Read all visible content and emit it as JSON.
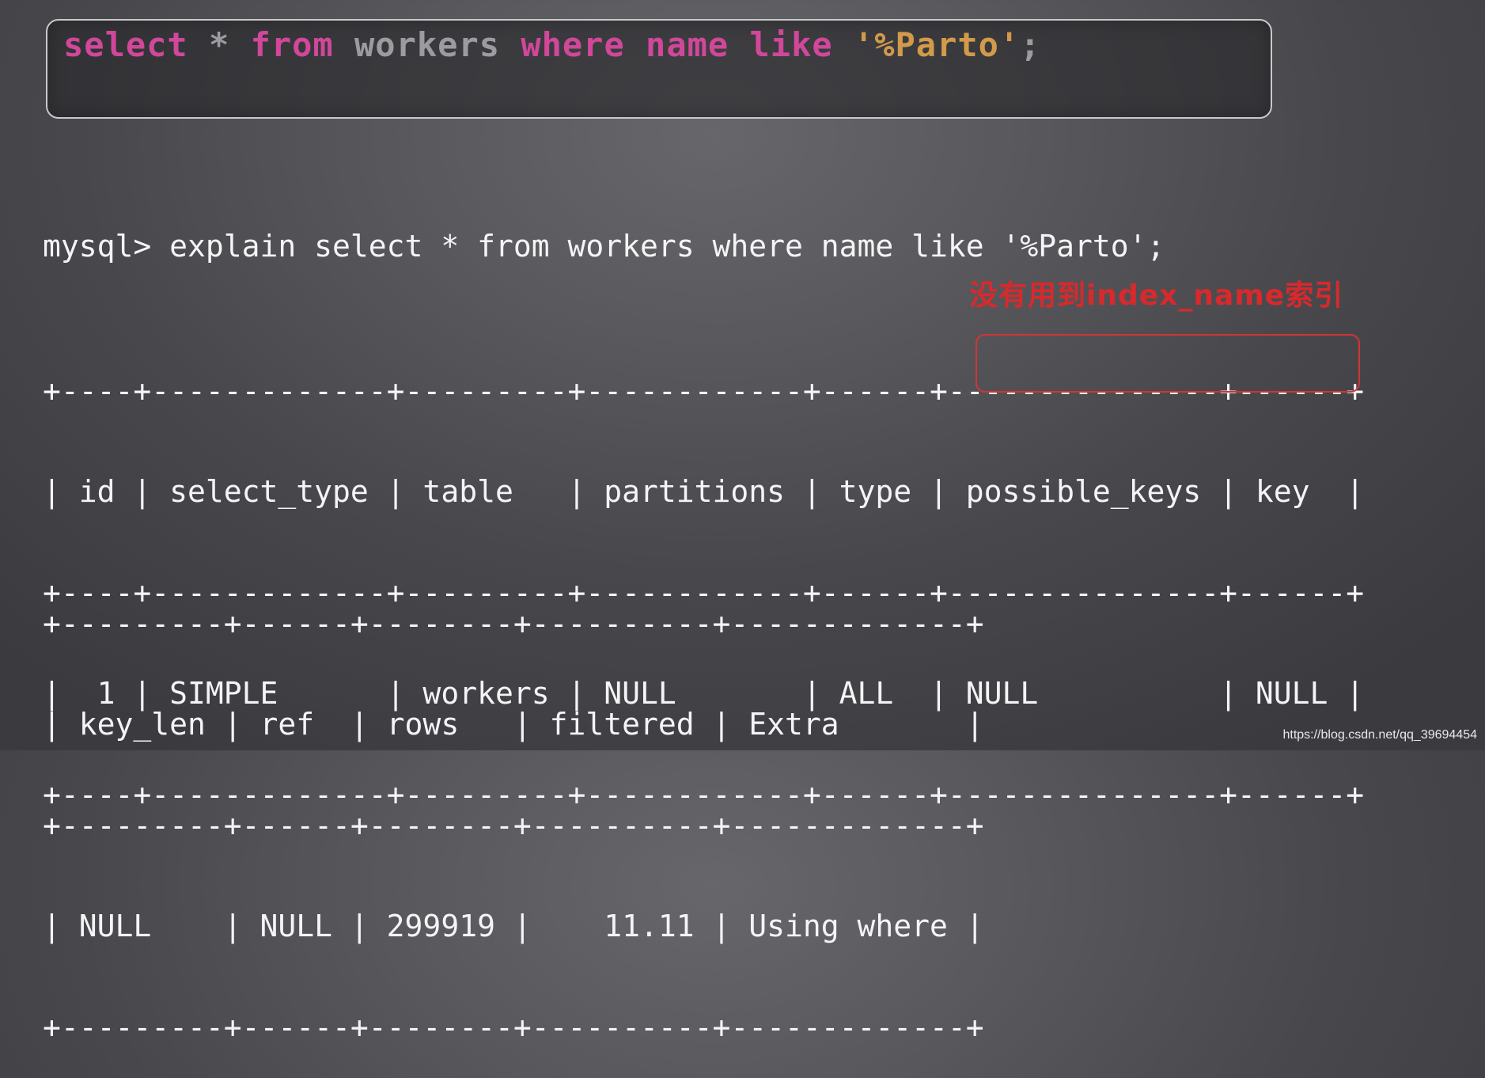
{
  "sql_box": {
    "tokens": [
      {
        "text": "select",
        "kind": "kw"
      },
      {
        "text": " * ",
        "kind": "plain"
      },
      {
        "text": "from",
        "kind": "kw"
      },
      {
        "text": " workers ",
        "kind": "plain"
      },
      {
        "text": "where",
        "kind": "kw"
      },
      {
        "text": " ",
        "kind": "plain"
      },
      {
        "text": "name",
        "kind": "kw"
      },
      {
        "text": " ",
        "kind": "plain"
      },
      {
        "text": "like",
        "kind": "kw"
      },
      {
        "text": " ",
        "kind": "plain"
      },
      {
        "text": "'%Parto'",
        "kind": "str"
      },
      {
        "text": ";",
        "kind": "plain"
      }
    ]
  },
  "terminal": {
    "prompt_line": "mysql> explain select * from workers where name like '%Parto';",
    "table1": {
      "border": "+----+-------------+---------+------------+------+---------------+------+",
      "header": "| id | select_type | table   | partitions | type | possible_keys | key  |",
      "row": "|  1 | SIMPLE      | workers | NULL       | ALL  | NULL          | NULL |"
    },
    "table2": {
      "border": "+---------+------+--------+----------+-------------+",
      "header": "| key_len | ref  | rows   | filtered | Extra       |",
      "row": "| NULL    | NULL | 299919 |    11.11 | Using where |"
    }
  },
  "annotation": {
    "text": "没有用到index_name索引",
    "color": "#d8292c"
  },
  "watermark": "https://blog.csdn.net/qq_39694454",
  "colors": {
    "keyword": "#d1479a",
    "plain": "#9b9ba1",
    "string": "#d29a4a",
    "terminal_text": "#f4f4f6"
  }
}
